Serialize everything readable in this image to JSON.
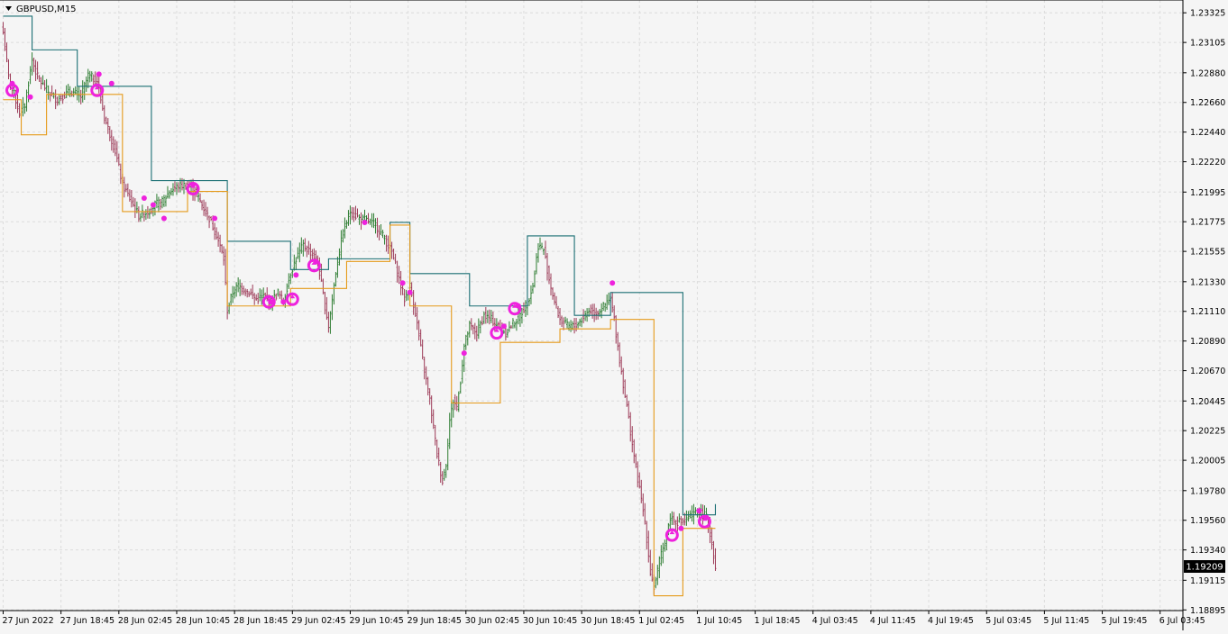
{
  "window": {
    "title": "GBPUSD,M15",
    "menu_icon": "triangle-down-icon"
  },
  "colors": {
    "background": "#f5f5f5",
    "grid": "#dcdcdc",
    "bull": "#2e7d32",
    "bear": "#9c3a57",
    "resistance": "#1b6f74",
    "support": "#e59a1a",
    "signal": "#ee22dd",
    "price_label_bg": "#000000",
    "price_label_text": "#ffffff"
  },
  "current_price": {
    "label": "1.19209",
    "value": 1.19209
  },
  "chart_data": {
    "type": "ohlc",
    "symbol": "GBPUSD",
    "timeframe": "M15",
    "title": "GBPUSD,M15",
    "ylim": [
      1.1889,
      1.2342
    ],
    "y_ticks": [
      "1.23325",
      "1.23105",
      "1.22880",
      "1.22660",
      "1.22440",
      "1.22220",
      "1.21995",
      "1.21775",
      "1.21555",
      "1.21330",
      "1.21110",
      "1.20890",
      "1.20670",
      "1.20445",
      "1.20225",
      "1.20005",
      "1.19780",
      "1.19560",
      "1.19340",
      "1.19115",
      "1.18895"
    ],
    "x_ticks": [
      "27 Jun 2022",
      "27 Jun 18:45",
      "28 Jun 02:45",
      "28 Jun 10:45",
      "28 Jun 18:45",
      "29 Jun 02:45",
      "29 Jun 10:45",
      "29 Jun 18:45",
      "30 Jun 02:45",
      "30 Jun 10:45",
      "30 Jun 18:45",
      "1 Jul 02:45",
      "1 Jul 10:45",
      "1 Jul 18:45",
      "4 Jul 03:45",
      "4 Jul 11:45",
      "4 Jul 19:45",
      "5 Jul 03:45",
      "5 Jul 11:45",
      "5 Jul 19:45",
      "6 Jul 03:45"
    ],
    "bars_per_tick": 32,
    "price_path": [
      [
        0,
        1.2318
      ],
      [
        3,
        1.2285
      ],
      [
        6,
        1.2272
      ],
      [
        9,
        1.2258
      ],
      [
        12,
        1.2264
      ],
      [
        16,
        1.2298
      ],
      [
        19,
        1.2285
      ],
      [
        24,
        1.2275
      ],
      [
        30,
        1.2268
      ],
      [
        34,
        1.2272
      ],
      [
        38,
        1.2274
      ],
      [
        43,
        1.227
      ],
      [
        47,
        1.2286
      ],
      [
        52,
        1.2282
      ],
      [
        56,
        1.2255
      ],
      [
        62,
        1.223
      ],
      [
        66,
        1.2205
      ],
      [
        70,
        1.2195
      ],
      [
        75,
        1.2182
      ],
      [
        80,
        1.2185
      ],
      [
        84,
        1.219
      ],
      [
        88,
        1.2192
      ],
      [
        92,
        1.22
      ],
      [
        97,
        1.2204
      ],
      [
        102,
        1.2205
      ],
      [
        106,
        1.22
      ],
      [
        110,
        1.219
      ],
      [
        114,
        1.218
      ],
      [
        118,
        1.2168
      ],
      [
        122,
        1.215
      ],
      [
        124,
        1.2112
      ],
      [
        127,
        1.2125
      ],
      [
        130,
        1.213
      ],
      [
        136,
        1.2125
      ],
      [
        140,
        1.212
      ],
      [
        144,
        1.2122
      ],
      [
        148,
        1.2118
      ],
      [
        152,
        1.2125
      ],
      [
        155,
        1.2118
      ],
      [
        159,
        1.214
      ],
      [
        162,
        1.215
      ],
      [
        166,
        1.216
      ],
      [
        170,
        1.2155
      ],
      [
        174,
        1.2148
      ],
      [
        178,
        1.2115
      ],
      [
        180,
        1.21
      ],
      [
        184,
        1.214
      ],
      [
        188,
        1.217
      ],
      [
        192,
        1.2185
      ],
      [
        197,
        1.218
      ],
      [
        202,
        1.2178
      ],
      [
        206,
        1.2175
      ],
      [
        211,
        1.2165
      ],
      [
        215,
        1.2155
      ],
      [
        219,
        1.2135
      ],
      [
        222,
        1.212
      ],
      [
        225,
        1.213
      ],
      [
        228,
        1.211
      ],
      [
        232,
        1.2075
      ],
      [
        236,
        1.2045
      ],
      [
        240,
        1.2005
      ],
      [
        243,
        1.1985
      ],
      [
        245,
        1.1998
      ],
      [
        247,
        1.203
      ],
      [
        249,
        1.2045
      ],
      [
        251,
        1.204
      ],
      [
        253,
        1.206
      ],
      [
        255,
        1.2085
      ],
      [
        258,
        1.21
      ],
      [
        262,
        1.2095
      ],
      [
        266,
        1.2108
      ],
      [
        270,
        1.2105
      ],
      [
        274,
        1.21
      ],
      [
        278,
        1.2095
      ],
      [
        282,
        1.2102
      ],
      [
        286,
        1.2108
      ],
      [
        290,
        1.2118
      ],
      [
        293,
        1.213
      ],
      [
        296,
        1.216
      ],
      [
        299,
        1.2157
      ],
      [
        302,
        1.2135
      ],
      [
        305,
        1.2118
      ],
      [
        308,
        1.2105
      ],
      [
        312,
        1.21
      ],
      [
        316,
        1.21
      ],
      [
        320,
        1.2105
      ],
      [
        324,
        1.2112
      ],
      [
        328,
        1.211
      ],
      [
        332,
        1.2114
      ],
      [
        336,
        1.212
      ],
      [
        338,
        1.2105
      ],
      [
        341,
        1.2075
      ],
      [
        345,
        1.204
      ],
      [
        350,
        1.1995
      ],
      [
        355,
        1.1955
      ],
      [
        358,
        1.1918
      ],
      [
        360,
        1.1906
      ],
      [
        363,
        1.1925
      ],
      [
        366,
        1.194
      ],
      [
        369,
        1.1958
      ],
      [
        373,
        1.1955
      ],
      [
        377,
        1.1955
      ],
      [
        381,
        1.196
      ],
      [
        385,
        1.1963
      ],
      [
        389,
        1.1958
      ],
      [
        392,
        1.194
      ],
      [
        394,
        1.1921
      ]
    ],
    "series": [
      {
        "name": "resistance",
        "steps": [
          [
            0,
            1.233
          ],
          [
            16,
            1.2305
          ],
          [
            41,
            1.2278
          ],
          [
            82,
            1.2208
          ],
          [
            124,
            1.2163
          ],
          [
            159,
            1.2142
          ],
          [
            180,
            1.215
          ],
          [
            214,
            1.2177
          ],
          [
            225,
            1.2139
          ],
          [
            258,
            1.2115
          ],
          [
            290,
            1.2167
          ],
          [
            316,
            1.2108
          ],
          [
            336,
            1.2125
          ],
          [
            376,
            1.196
          ],
          [
            394,
            1.1968
          ]
        ]
      },
      {
        "name": "support",
        "steps": [
          [
            0,
            1.2268
          ],
          [
            10,
            1.2242
          ],
          [
            24,
            1.2272
          ],
          [
            66,
            1.2185
          ],
          [
            102,
            1.22
          ],
          [
            124,
            1.2115
          ],
          [
            159,
            1.2128
          ],
          [
            190,
            1.2148
          ],
          [
            214,
            1.2175
          ],
          [
            225,
            1.2115
          ],
          [
            248,
            1.2043
          ],
          [
            275,
            1.2088
          ],
          [
            308,
            1.2098
          ],
          [
            336,
            1.2105
          ],
          [
            360,
            1.19
          ],
          [
            376,
            1.195
          ],
          [
            394,
            1.195
          ]
        ]
      }
    ],
    "dots": [
      [
        5,
        1.228
      ],
      [
        15,
        1.227
      ],
      [
        53,
        1.2287
      ],
      [
        60,
        1.228
      ],
      [
        78,
        1.2195
      ],
      [
        83,
        1.219
      ],
      [
        89,
        1.218
      ],
      [
        105,
        1.2205
      ],
      [
        117,
        1.218
      ],
      [
        148,
        1.2118
      ],
      [
        155,
        1.2118
      ],
      [
        162,
        1.2138
      ],
      [
        173,
        1.2148
      ],
      [
        200,
        1.2177
      ],
      [
        221,
        1.2132
      ],
      [
        225,
        1.2125
      ],
      [
        255,
        1.208
      ],
      [
        277,
        1.21
      ],
      [
        285,
        1.2115
      ],
      [
        337,
        1.2132
      ],
      [
        375,
        1.195
      ],
      [
        385,
        1.1963
      ],
      [
        389,
        1.1958
      ]
    ],
    "arrows": [
      [
        5,
        1.2275
      ],
      [
        52,
        1.2275
      ],
      [
        105,
        1.2202
      ],
      [
        147,
        1.2118
      ],
      [
        160,
        1.212
      ],
      [
        172,
        1.2145
      ],
      [
        273,
        1.2095
      ],
      [
        283,
        1.2113
      ],
      [
        370,
        1.1945
      ],
      [
        388,
        1.1955
      ]
    ]
  }
}
